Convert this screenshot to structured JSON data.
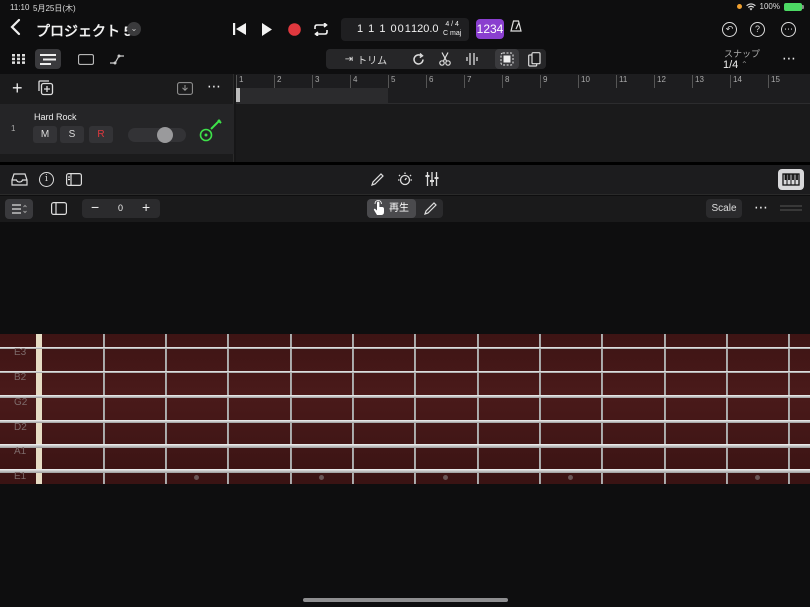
{
  "status": {
    "time": "11:10",
    "date": "5月25日(木)",
    "battery": "100%"
  },
  "header": {
    "title": "プロジェクト 5"
  },
  "lcd": {
    "position": "1 1 1 001",
    "tempo": "120.0",
    "signature": "4 / 4",
    "key": "C maj"
  },
  "countin": "1234",
  "tools": {
    "trim_label": "トリム",
    "snap_label": "スナップ",
    "snap_value": "1/4"
  },
  "ruler": {
    "bars": [
      "1",
      "2",
      "3",
      "4",
      "5",
      "6",
      "7",
      "8",
      "9",
      "10",
      "11",
      "12",
      "13",
      "14",
      "15"
    ]
  },
  "track": {
    "number": "1",
    "name": "Hard Rock",
    "mute": "M",
    "solo": "S",
    "record": "R",
    "volume": 0.7
  },
  "editor": {
    "transpose_value": "0",
    "play_label": "再生",
    "scale_label": "Scale"
  },
  "fretboard": {
    "strings": [
      "E3",
      "B2",
      "G2",
      "D2",
      "A1",
      "E1"
    ]
  },
  "colors": {
    "record": "#e0383e",
    "countin": "#8a3fcf",
    "guitar": "#3ee24a",
    "fretboard": "#4a1a1a"
  }
}
